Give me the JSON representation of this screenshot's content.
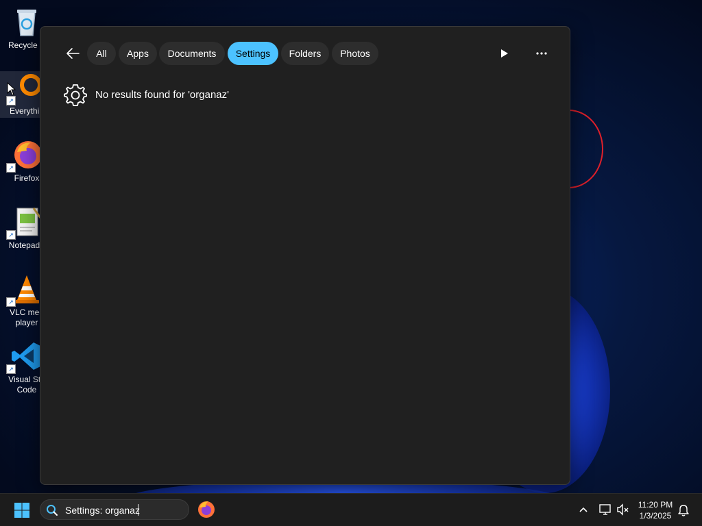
{
  "desktop": {
    "icons": [
      {
        "name": "recycle-bin",
        "label": "Recycle B",
        "label2": ""
      },
      {
        "name": "everything",
        "label": "Everythin",
        "label2": ""
      },
      {
        "name": "firefox",
        "label": "Firefox",
        "label2": ""
      },
      {
        "name": "notepad",
        "label": "Notepad+",
        "label2": ""
      },
      {
        "name": "vlc",
        "label": "VLC med",
        "label2": "player"
      },
      {
        "name": "vscode",
        "label": "Visual Stu",
        "label2": "Code"
      }
    ]
  },
  "flyout": {
    "filters": [
      "All",
      "Apps",
      "Documents",
      "Settings",
      "Folders",
      "Photos"
    ],
    "active_filter": "Settings",
    "result_icon": "gear-icon",
    "no_results_text": "No results found for 'organaz'",
    "more_label": "···"
  },
  "taskbar": {
    "search_value": "Settings: organaz",
    "clock_time": "11:20 PM",
    "clock_date": "1/3/2025"
  },
  "colors": {
    "accent": "#4cc2ff",
    "flyout_bg": "#202020",
    "pill_bg": "#2d2d2d",
    "taskbar_bg": "#1c1c1c"
  }
}
